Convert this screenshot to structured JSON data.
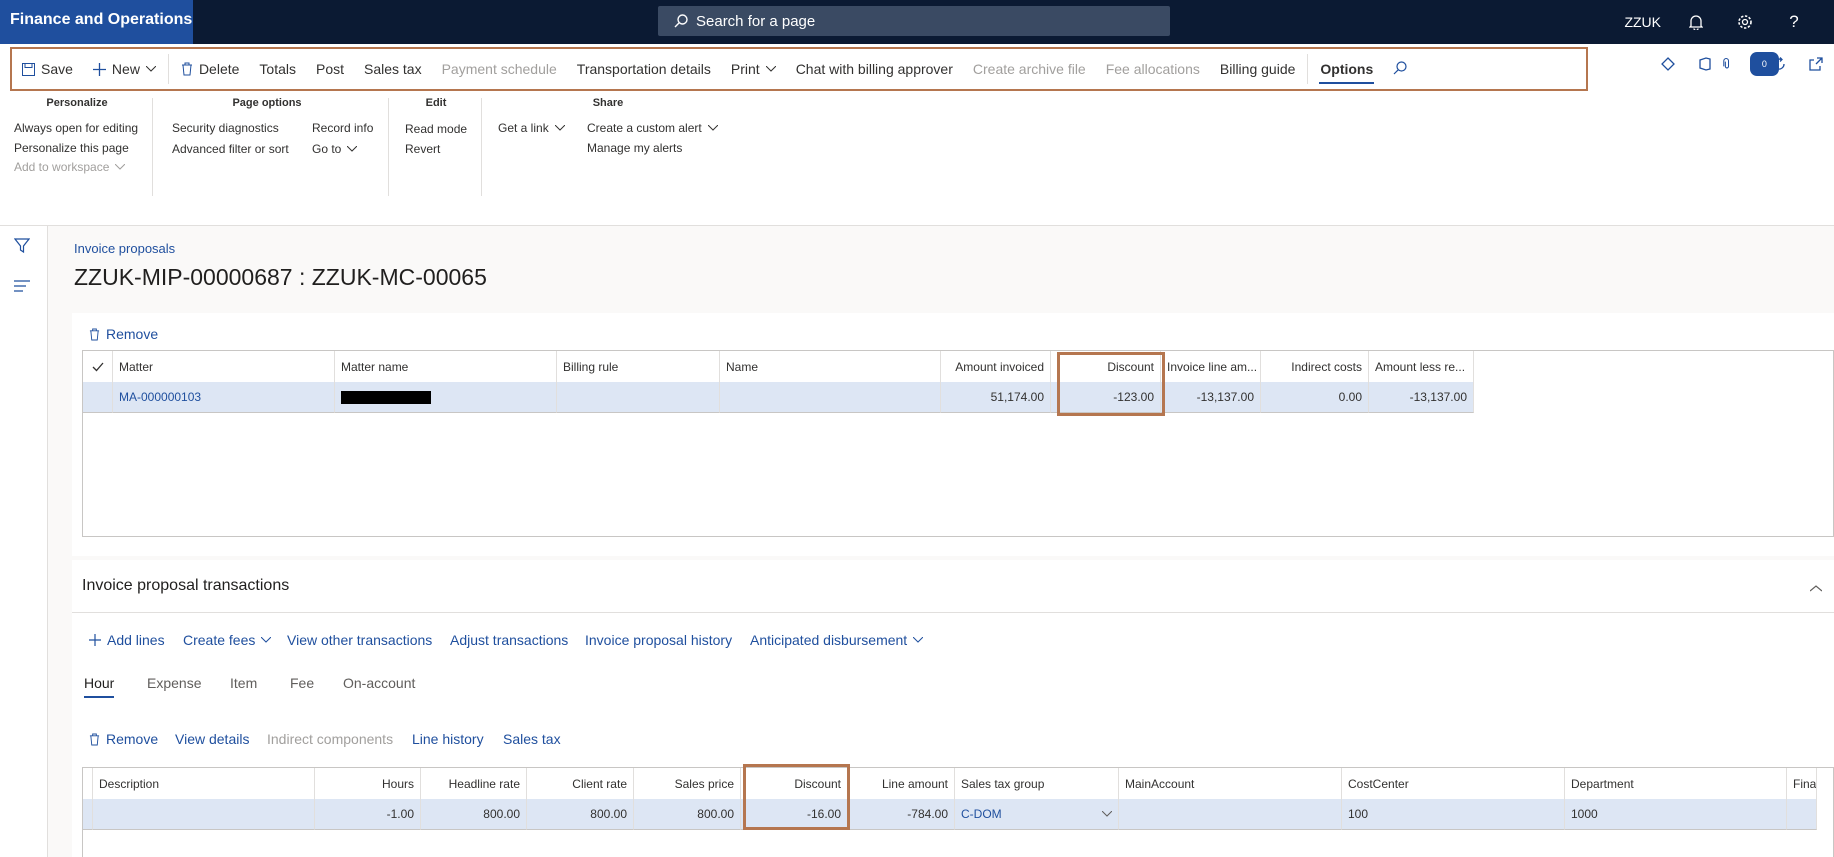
{
  "app": {
    "title": "Finance and Operations",
    "search_placeholder": "Search for a page",
    "company": "ZZUK"
  },
  "action_bar": {
    "save": "Save",
    "new": "New",
    "delete": "Delete",
    "totals": "Totals",
    "post": "Post",
    "sales_tax": "Sales tax",
    "payment_schedule": "Payment schedule",
    "transportation_details": "Transportation details",
    "print": "Print",
    "chat": "Chat with billing approver",
    "create_archive": "Create archive file",
    "fee_allocations": "Fee allocations",
    "billing_guide": "Billing guide",
    "options": "Options",
    "notification_count": "0"
  },
  "ribbon": {
    "personalize": {
      "title": "Personalize",
      "always_open": "Always open for editing",
      "personalize_page": "Personalize this page",
      "add_workspace": "Add to workspace"
    },
    "page_options": {
      "title": "Page options",
      "security": "Security diagnostics",
      "advanced_filter": "Advanced filter or sort",
      "record_info": "Record info",
      "go_to": "Go to"
    },
    "edit": {
      "title": "Edit",
      "read_mode": "Read mode",
      "revert": "Revert"
    },
    "share": {
      "title": "Share",
      "get_link": "Get a link",
      "custom_alert": "Create a custom alert",
      "manage_alerts": "Manage my alerts"
    }
  },
  "page": {
    "breadcrumb": "Invoice proposals",
    "title": "ZZUK-MIP-00000687 : ZZUK-MC-00065"
  },
  "matter_grid": {
    "remove": "Remove",
    "headers": [
      "Matter",
      "Matter name",
      "Billing rule",
      "Name",
      "Amount invoiced",
      "Discount",
      "Invoice line am...",
      "Indirect costs",
      "Amount less re..."
    ],
    "row": {
      "matter": "MA-000000103",
      "matter_name": "",
      "billing_rule": "",
      "name": "",
      "amount_invoiced": "51,174.00",
      "discount": "-123.00",
      "invoice_line_amount": "-13,137.00",
      "indirect_costs": "0.00",
      "amount_less": "-13,137.00"
    }
  },
  "transactions": {
    "title": "Invoice proposal transactions",
    "toolbar": {
      "add_lines": "Add lines",
      "create_fees": "Create fees",
      "view_other": "View other transactions",
      "adjust": "Adjust transactions",
      "history": "Invoice proposal history",
      "anticipated": "Anticipated disbursement"
    },
    "tabs": [
      "Hour",
      "Expense",
      "Item",
      "Fee",
      "On-account"
    ],
    "sub_toolbar": {
      "remove": "Remove",
      "view_details": "View details",
      "indirect": "Indirect components",
      "line_history": "Line history",
      "sales_tax": "Sales tax"
    },
    "headers": [
      "Description",
      "Hours",
      "Headline rate",
      "Client rate",
      "Sales price",
      "Discount",
      "Line amount",
      "Sales tax group",
      "MainAccount",
      "CostCenter",
      "Department",
      "Finar"
    ],
    "row": {
      "description": "",
      "hours": "-1.00",
      "headline_rate": "800.00",
      "client_rate": "800.00",
      "sales_price": "800.00",
      "discount": "-16.00",
      "line_amount": "-784.00",
      "sales_tax_group": "C-DOM",
      "main_account": "",
      "cost_center": "100",
      "department": "1000",
      "finan": ""
    }
  }
}
